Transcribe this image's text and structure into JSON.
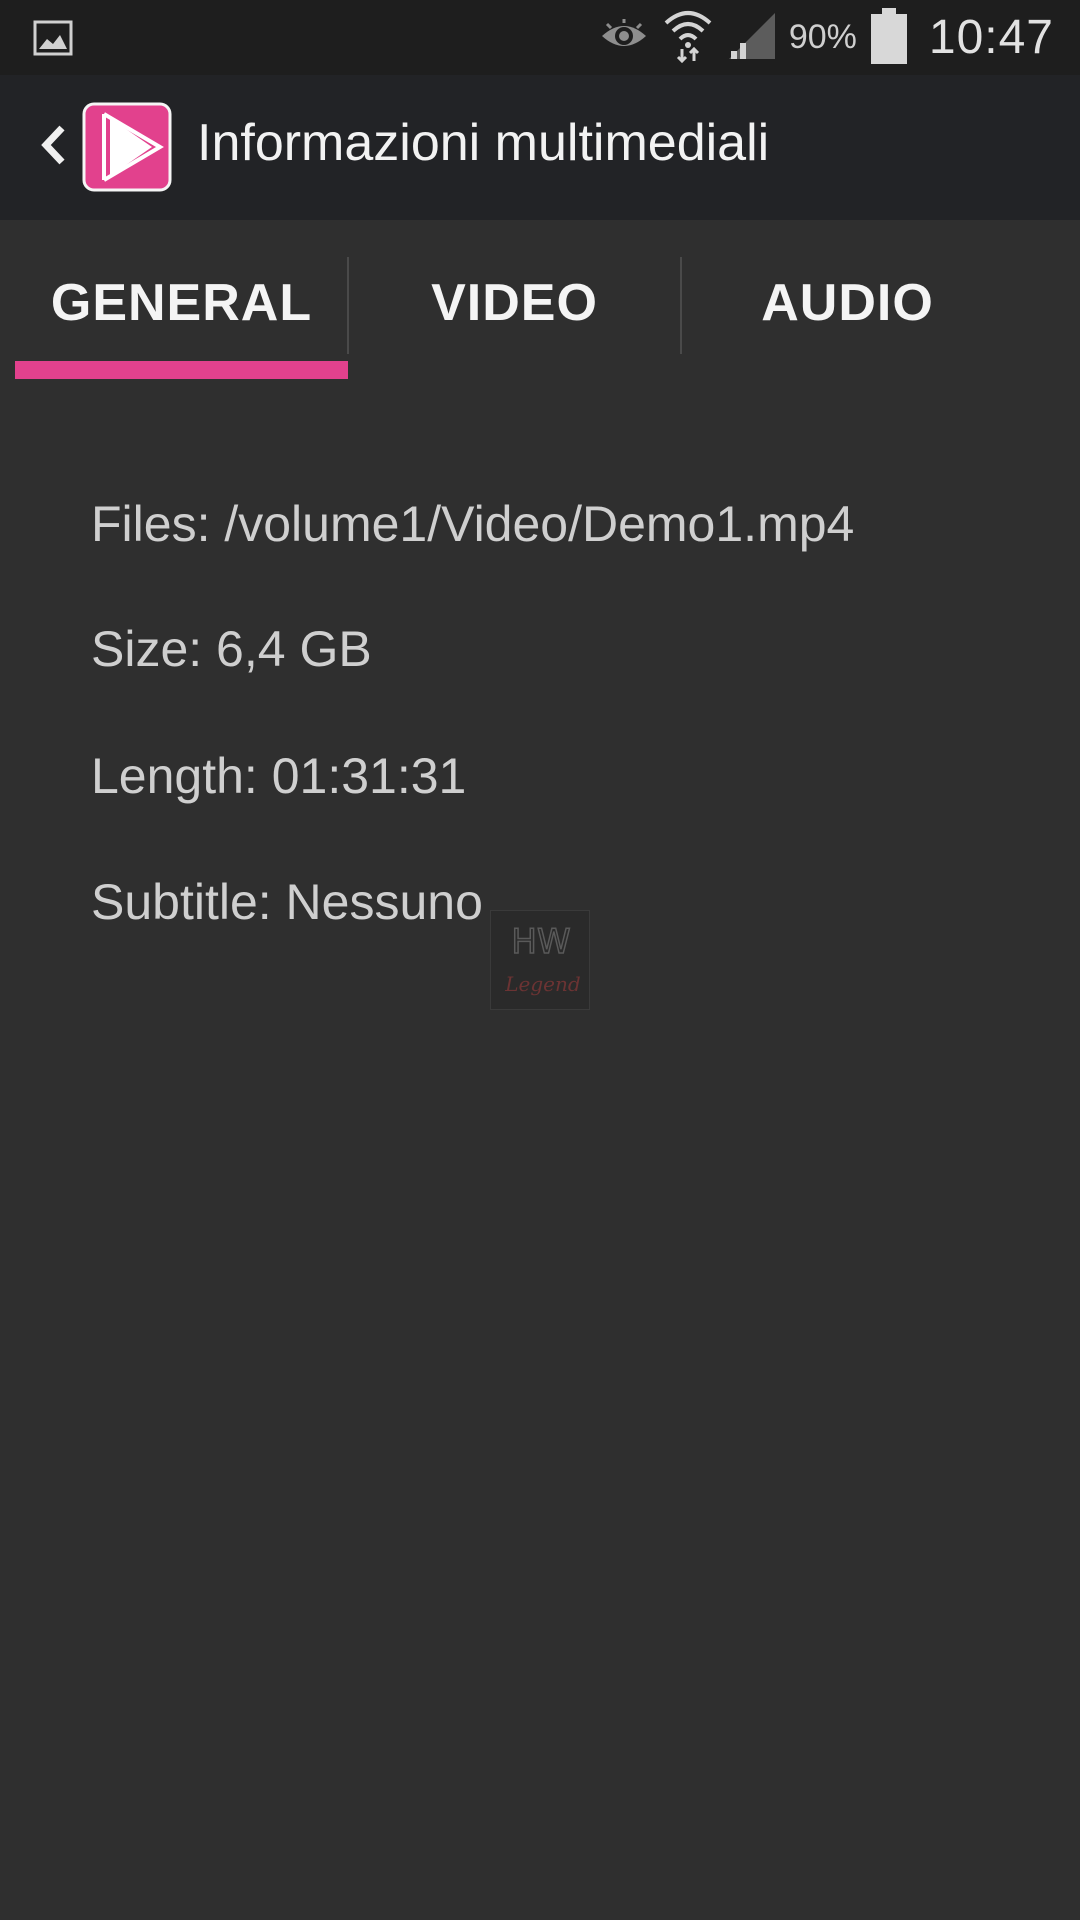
{
  "status_bar": {
    "battery_percent": "90%",
    "time": "10:47",
    "icons": [
      "gallery-notification-icon",
      "eye-icon",
      "wifi-icon",
      "signal-icon",
      "battery-icon"
    ]
  },
  "action_bar": {
    "title": "Informazioni multimediali",
    "app_icon": "play-icon",
    "accent_color": "#e2418d"
  },
  "tabs": [
    {
      "label": "GENERAL",
      "selected": true
    },
    {
      "label": "VIDEO",
      "selected": false
    },
    {
      "label": "AUDIO",
      "selected": false
    }
  ],
  "general_info": {
    "files": "Files: /volume1/Video/Demo1.mp4",
    "size": "Size: 6,4 GB",
    "length": "Length: 01:31:31",
    "subtitle": "Subtitle: Nessuno"
  },
  "watermark": {
    "top": "HW",
    "bottom": "Legend"
  }
}
